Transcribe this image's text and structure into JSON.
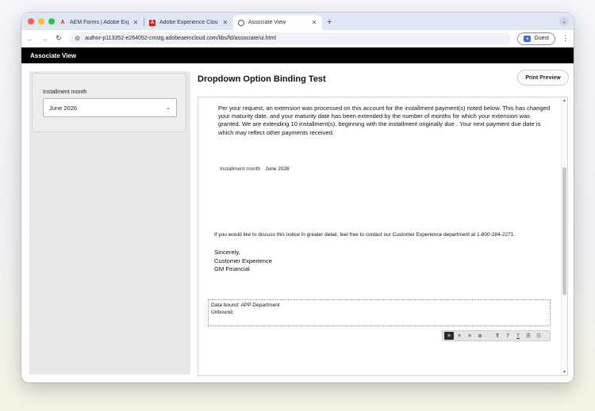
{
  "browser": {
    "tabs": [
      {
        "label": "AEM Forms | Adobe Experience",
        "icon": "adobe-logo-icon",
        "active": false
      },
      {
        "label": "Adobe Experience Cloud",
        "icon": "adobe-logo-icon",
        "active": false
      },
      {
        "label": "Associate View",
        "icon": "globe-icon",
        "active": true
      }
    ],
    "new_tab_glyph": "+",
    "url": "author-p113352-e264052-cmstg.adobeaemcloud.com/libs/fd/associate/ui.html",
    "profile_label": "Guest"
  },
  "app": {
    "header_title": "Associate View"
  },
  "sidebar": {
    "field_label": "Installment month",
    "selected_value": "June 2026"
  },
  "document": {
    "title": "Dropdown Option Binding Test",
    "print_button": "Print Preview",
    "paragraph": "Per your request, an extension was processed on this account for the installment payment(s) noted below. This has changed your maturity date, and your maturity date has been extended by the number of months for which your extension was granted. We are extending 10 installment(s), beginning with the installment originally due . Your next payment due date is  which may reflect other payments received.",
    "installment_label": "Installment month",
    "installment_value": "June 2026",
    "contact_text": "If you would like to discuss this notice in greater detail, feel free to contact our Customer Experience department at 1-800-284-2271.",
    "signoff": [
      "Sincerely,",
      "Customer Experience",
      "GM Financial"
    ],
    "data_bound": "Data bound: APP Department",
    "unbound": "Unbound:"
  },
  "rte_toolbar": {
    "buttons": [
      "align-left-icon",
      "align-center-icon",
      "align-right-icon",
      "align-justify-icon",
      "bold-icon",
      "italic-icon",
      "underline-icon",
      "bullet-list-icon",
      "numbered-list-icon"
    ]
  },
  "colors": {
    "app_header_bg": "#000000",
    "tabstrip_bg": "#dfe7f5",
    "sidebar_bg": "#e8e8e8"
  }
}
